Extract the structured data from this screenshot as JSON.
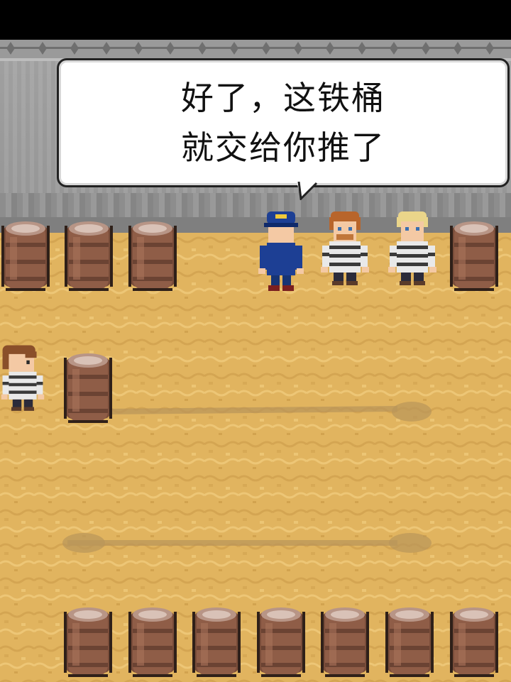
{
  "dialog": {
    "line1": "好了，这铁桶",
    "line2": "就交给你推了"
  },
  "colors": {
    "wall": "#a0a0a0",
    "floor": "#e0b25d",
    "barrel": "#8a5a43",
    "guard_uniform": "#1d3f94",
    "prisoner_stripes": "#e9e9e9"
  },
  "sprites": {
    "guard": "guard-sprite",
    "prisoner_redhair": "prisoner-sprite",
    "prisoner_blond": "prisoner-sprite",
    "player": "player-prisoner-sprite",
    "barrel": "barrel-sprite"
  }
}
